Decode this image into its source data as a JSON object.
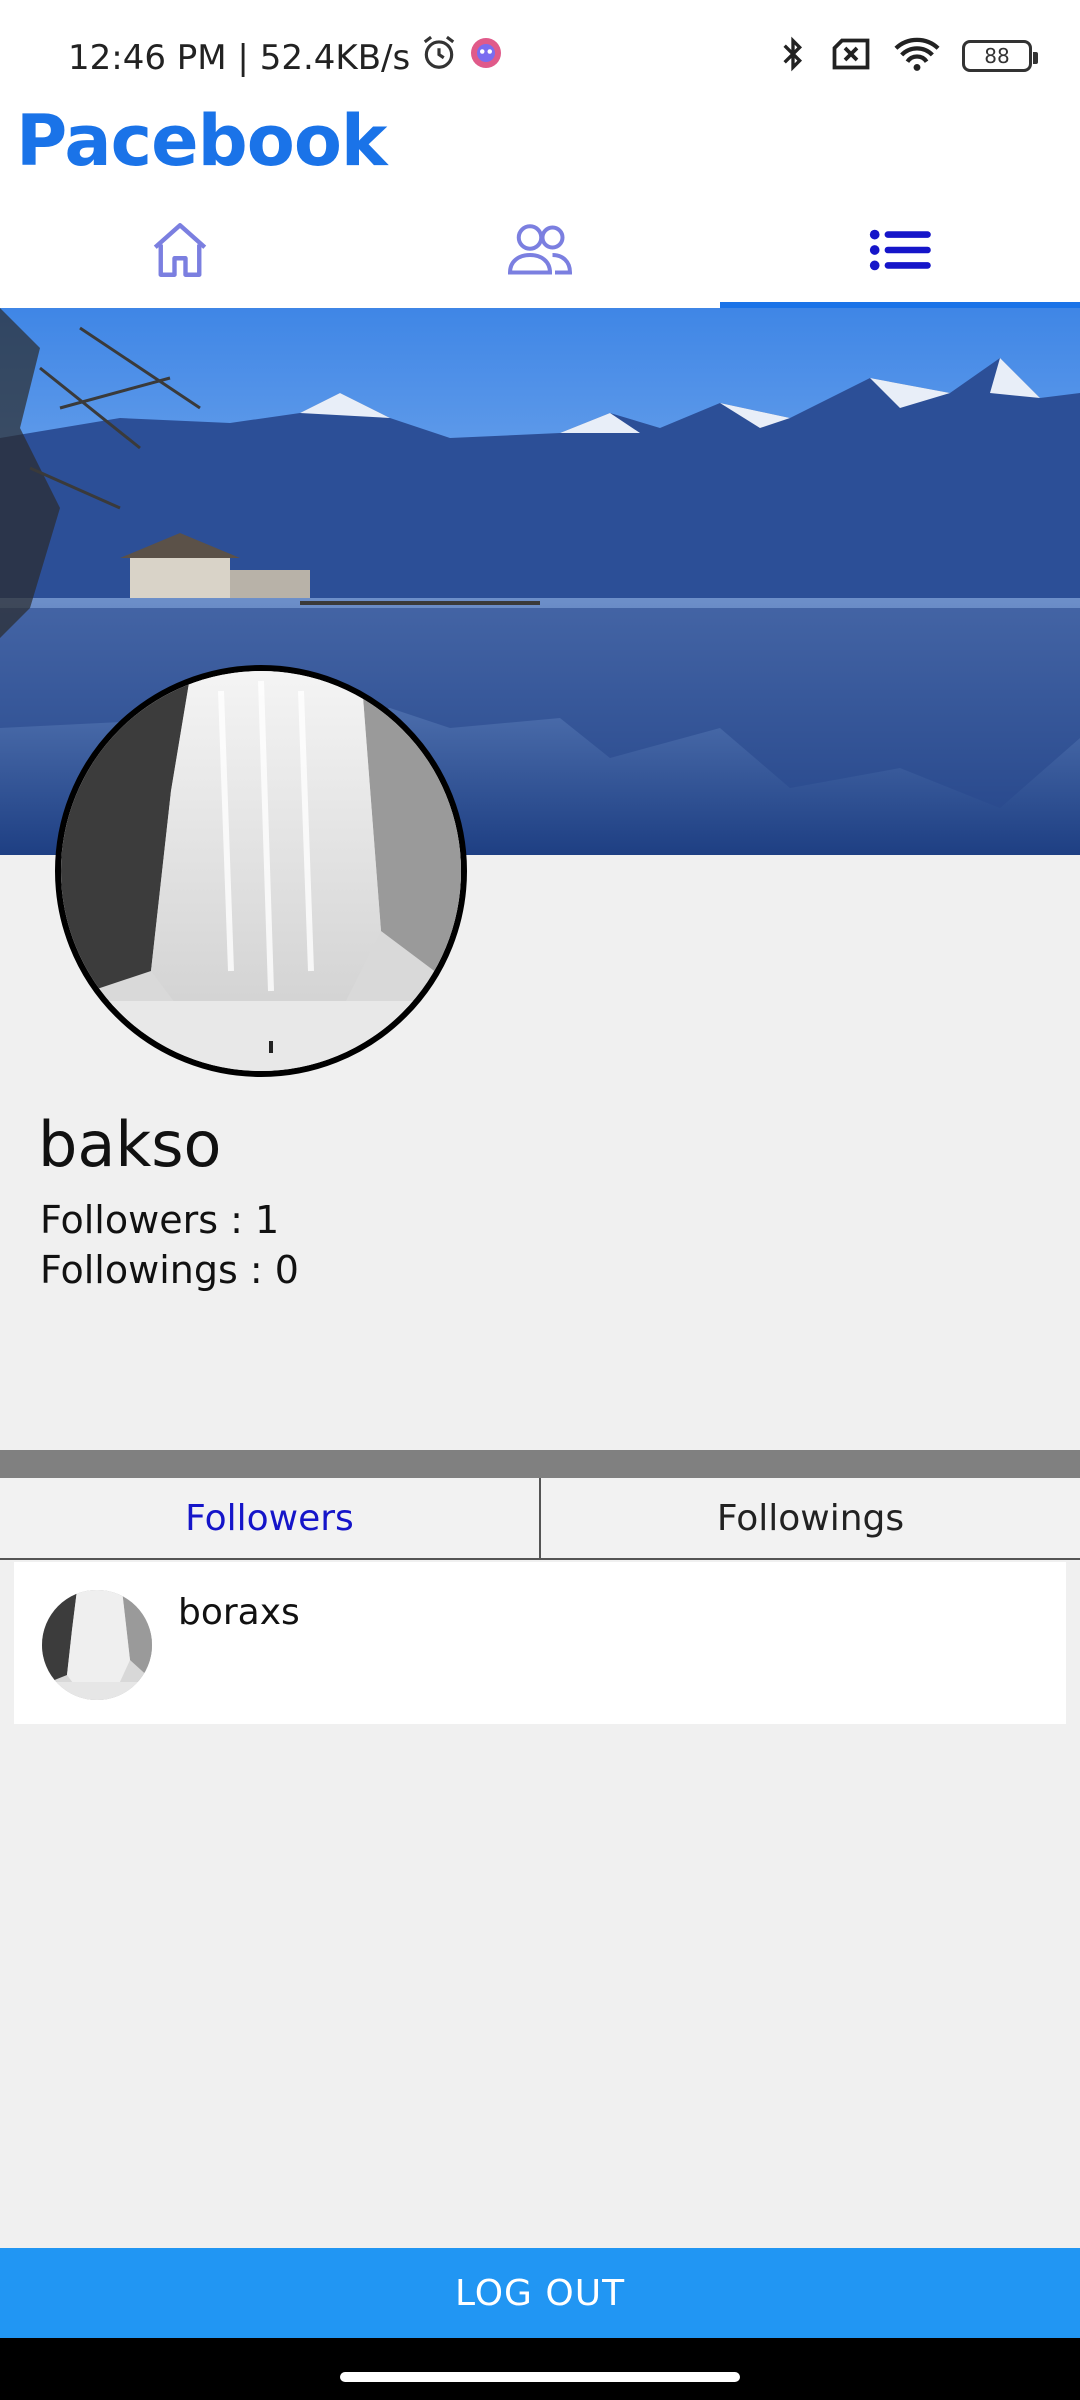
{
  "status_bar": {
    "time_speed": "12:46 PM | 52.4KB/s",
    "battery": "88"
  },
  "app": {
    "title": "Pacebook",
    "colors": {
      "brand": "#1a73e8",
      "accent": "#2196f3",
      "active_tab_text": "#1515c9"
    }
  },
  "top_tabs": [
    {
      "icon": "home-icon"
    },
    {
      "icon": "people-icon"
    },
    {
      "icon": "list-icon",
      "active": true
    }
  ],
  "profile": {
    "username": "bakso",
    "followers_text": "Followers : 1",
    "followings_text": "Followings : 0"
  },
  "segment": {
    "followers_label": "Followers",
    "followings_label": "Followings",
    "active": "Followers"
  },
  "followers_list": [
    {
      "name": "boraxs"
    }
  ],
  "logout_label": "LOG OUT"
}
